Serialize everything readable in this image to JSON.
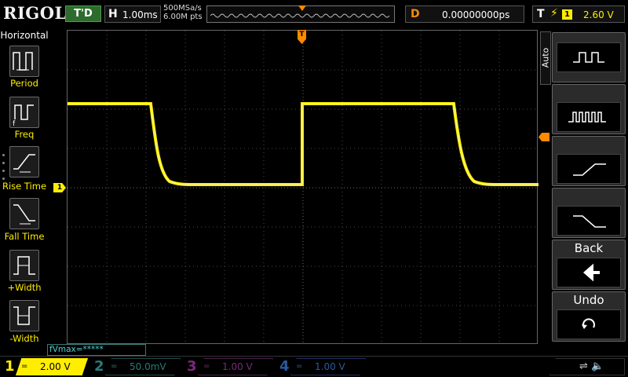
{
  "brand": "RIGOL",
  "status": "T'D",
  "horizontal": {
    "label": "H",
    "timebase": "1.00ms",
    "sample_rate": "500MSa/s",
    "memory": "6.00M pts"
  },
  "delay": {
    "label": "D",
    "value": "0.00000000ps"
  },
  "trigger": {
    "label": "T",
    "edge_icon": "rising-edge-icon",
    "source": "1",
    "level": "2.60 V",
    "marker": "T"
  },
  "menu": {
    "title": "Horizontal",
    "items": [
      {
        "label": "Period",
        "icon": "period-icon"
      },
      {
        "label": "Freq",
        "icon": "frequency-icon"
      },
      {
        "label": "Rise Time",
        "icon": "rise-time-icon"
      },
      {
        "label": "Fall Time",
        "icon": "fall-time-icon"
      },
      {
        "label": "+Width",
        "icon": "positive-width-icon"
      },
      {
        "label": "-Width",
        "icon": "negative-width-icon"
      }
    ]
  },
  "measurement_readout": "fVmax=*****",
  "softkeys": {
    "mode": "Auto",
    "back_label": "Back",
    "undo_label": "Undo"
  },
  "channels": [
    {
      "number": "1",
      "coupling": "=",
      "scale": "2.00 V",
      "color": "#ffee00",
      "active": true
    },
    {
      "number": "2",
      "coupling": "=",
      "scale": "50.0mV",
      "color": "#00c8c8",
      "active": false
    },
    {
      "number": "3",
      "coupling": "=",
      "scale": "1.00 V",
      "color": "#c000c0",
      "active": false
    },
    {
      "number": "4",
      "coupling": "=",
      "scale": "1.00 V",
      "color": "#2a6fd6",
      "active": false
    }
  ],
  "ch1_marker": "1",
  "colors": {
    "trace": "#ffee00",
    "trigger": "#ff8a00",
    "grid": "#5a5a5a"
  }
}
